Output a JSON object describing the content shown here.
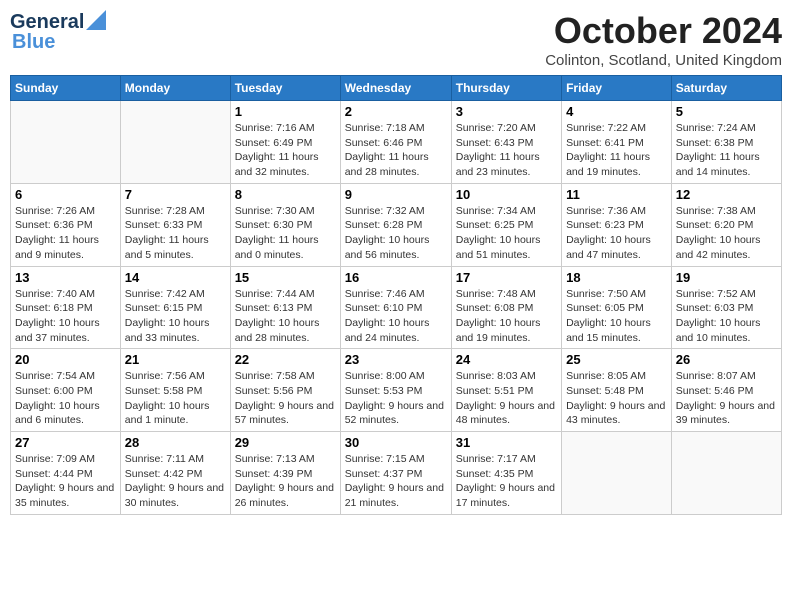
{
  "header": {
    "logo_line1": "General",
    "logo_line2": "Blue",
    "month_title": "October 2024",
    "location": "Colinton, Scotland, United Kingdom"
  },
  "weekdays": [
    "Sunday",
    "Monday",
    "Tuesday",
    "Wednesday",
    "Thursday",
    "Friday",
    "Saturday"
  ],
  "weeks": [
    [
      {
        "day": "",
        "sunrise": "",
        "sunset": "",
        "daylight": ""
      },
      {
        "day": "",
        "sunrise": "",
        "sunset": "",
        "daylight": ""
      },
      {
        "day": "1",
        "sunrise": "Sunrise: 7:16 AM",
        "sunset": "Sunset: 6:49 PM",
        "daylight": "Daylight: 11 hours and 32 minutes."
      },
      {
        "day": "2",
        "sunrise": "Sunrise: 7:18 AM",
        "sunset": "Sunset: 6:46 PM",
        "daylight": "Daylight: 11 hours and 28 minutes."
      },
      {
        "day": "3",
        "sunrise": "Sunrise: 7:20 AM",
        "sunset": "Sunset: 6:43 PM",
        "daylight": "Daylight: 11 hours and 23 minutes."
      },
      {
        "day": "4",
        "sunrise": "Sunrise: 7:22 AM",
        "sunset": "Sunset: 6:41 PM",
        "daylight": "Daylight: 11 hours and 19 minutes."
      },
      {
        "day": "5",
        "sunrise": "Sunrise: 7:24 AM",
        "sunset": "Sunset: 6:38 PM",
        "daylight": "Daylight: 11 hours and 14 minutes."
      }
    ],
    [
      {
        "day": "6",
        "sunrise": "Sunrise: 7:26 AM",
        "sunset": "Sunset: 6:36 PM",
        "daylight": "Daylight: 11 hours and 9 minutes."
      },
      {
        "day": "7",
        "sunrise": "Sunrise: 7:28 AM",
        "sunset": "Sunset: 6:33 PM",
        "daylight": "Daylight: 11 hours and 5 minutes."
      },
      {
        "day": "8",
        "sunrise": "Sunrise: 7:30 AM",
        "sunset": "Sunset: 6:30 PM",
        "daylight": "Daylight: 11 hours and 0 minutes."
      },
      {
        "day": "9",
        "sunrise": "Sunrise: 7:32 AM",
        "sunset": "Sunset: 6:28 PM",
        "daylight": "Daylight: 10 hours and 56 minutes."
      },
      {
        "day": "10",
        "sunrise": "Sunrise: 7:34 AM",
        "sunset": "Sunset: 6:25 PM",
        "daylight": "Daylight: 10 hours and 51 minutes."
      },
      {
        "day": "11",
        "sunrise": "Sunrise: 7:36 AM",
        "sunset": "Sunset: 6:23 PM",
        "daylight": "Daylight: 10 hours and 47 minutes."
      },
      {
        "day": "12",
        "sunrise": "Sunrise: 7:38 AM",
        "sunset": "Sunset: 6:20 PM",
        "daylight": "Daylight: 10 hours and 42 minutes."
      }
    ],
    [
      {
        "day": "13",
        "sunrise": "Sunrise: 7:40 AM",
        "sunset": "Sunset: 6:18 PM",
        "daylight": "Daylight: 10 hours and 37 minutes."
      },
      {
        "day": "14",
        "sunrise": "Sunrise: 7:42 AM",
        "sunset": "Sunset: 6:15 PM",
        "daylight": "Daylight: 10 hours and 33 minutes."
      },
      {
        "day": "15",
        "sunrise": "Sunrise: 7:44 AM",
        "sunset": "Sunset: 6:13 PM",
        "daylight": "Daylight: 10 hours and 28 minutes."
      },
      {
        "day": "16",
        "sunrise": "Sunrise: 7:46 AM",
        "sunset": "Sunset: 6:10 PM",
        "daylight": "Daylight: 10 hours and 24 minutes."
      },
      {
        "day": "17",
        "sunrise": "Sunrise: 7:48 AM",
        "sunset": "Sunset: 6:08 PM",
        "daylight": "Daylight: 10 hours and 19 minutes."
      },
      {
        "day": "18",
        "sunrise": "Sunrise: 7:50 AM",
        "sunset": "Sunset: 6:05 PM",
        "daylight": "Daylight: 10 hours and 15 minutes."
      },
      {
        "day": "19",
        "sunrise": "Sunrise: 7:52 AM",
        "sunset": "Sunset: 6:03 PM",
        "daylight": "Daylight: 10 hours and 10 minutes."
      }
    ],
    [
      {
        "day": "20",
        "sunrise": "Sunrise: 7:54 AM",
        "sunset": "Sunset: 6:00 PM",
        "daylight": "Daylight: 10 hours and 6 minutes."
      },
      {
        "day": "21",
        "sunrise": "Sunrise: 7:56 AM",
        "sunset": "Sunset: 5:58 PM",
        "daylight": "Daylight: 10 hours and 1 minute."
      },
      {
        "day": "22",
        "sunrise": "Sunrise: 7:58 AM",
        "sunset": "Sunset: 5:56 PM",
        "daylight": "Daylight: 9 hours and 57 minutes."
      },
      {
        "day": "23",
        "sunrise": "Sunrise: 8:00 AM",
        "sunset": "Sunset: 5:53 PM",
        "daylight": "Daylight: 9 hours and 52 minutes."
      },
      {
        "day": "24",
        "sunrise": "Sunrise: 8:03 AM",
        "sunset": "Sunset: 5:51 PM",
        "daylight": "Daylight: 9 hours and 48 minutes."
      },
      {
        "day": "25",
        "sunrise": "Sunrise: 8:05 AM",
        "sunset": "Sunset: 5:48 PM",
        "daylight": "Daylight: 9 hours and 43 minutes."
      },
      {
        "day": "26",
        "sunrise": "Sunrise: 8:07 AM",
        "sunset": "Sunset: 5:46 PM",
        "daylight": "Daylight: 9 hours and 39 minutes."
      }
    ],
    [
      {
        "day": "27",
        "sunrise": "Sunrise: 7:09 AM",
        "sunset": "Sunset: 4:44 PM",
        "daylight": "Daylight: 9 hours and 35 minutes."
      },
      {
        "day": "28",
        "sunrise": "Sunrise: 7:11 AM",
        "sunset": "Sunset: 4:42 PM",
        "daylight": "Daylight: 9 hours and 30 minutes."
      },
      {
        "day": "29",
        "sunrise": "Sunrise: 7:13 AM",
        "sunset": "Sunset: 4:39 PM",
        "daylight": "Daylight: 9 hours and 26 minutes."
      },
      {
        "day": "30",
        "sunrise": "Sunrise: 7:15 AM",
        "sunset": "Sunset: 4:37 PM",
        "daylight": "Daylight: 9 hours and 21 minutes."
      },
      {
        "day": "31",
        "sunrise": "Sunrise: 7:17 AM",
        "sunset": "Sunset: 4:35 PM",
        "daylight": "Daylight: 9 hours and 17 minutes."
      },
      {
        "day": "",
        "sunrise": "",
        "sunset": "",
        "daylight": ""
      },
      {
        "day": "",
        "sunrise": "",
        "sunset": "",
        "daylight": ""
      }
    ]
  ]
}
